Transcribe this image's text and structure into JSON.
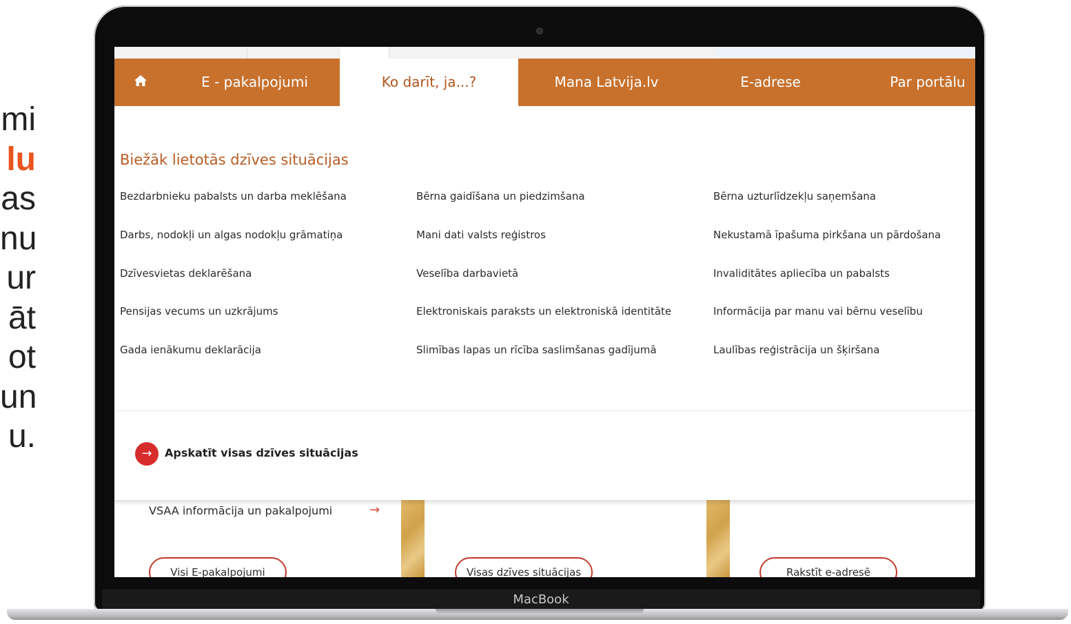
{
  "side_text": {
    "lines": [
      {
        "text": "mi",
        "accent": false
      },
      {
        "text": "lu",
        "accent": true
      },
      {
        "text": "as",
        "accent": false
      },
      {
        "text": "nu",
        "accent": false
      },
      {
        "text": "ur",
        "accent": false
      },
      {
        "text": "āt",
        "accent": false
      },
      {
        "text": "ot",
        "accent": false
      },
      {
        "text": "un",
        "accent": false
      },
      {
        "text": "u.",
        "accent": false
      }
    ]
  },
  "device": {
    "label": "MacBook"
  },
  "nav": {
    "home_icon": "home-icon",
    "items": [
      {
        "label": "E - pakalpojumi",
        "active": false
      },
      {
        "label": "Ko darīt, ja...?",
        "active": true
      },
      {
        "label": "Mana Latvija.lv",
        "active": false
      },
      {
        "label": "E-adrese",
        "active": false
      },
      {
        "label": "Par portālu",
        "active": false
      }
    ]
  },
  "mega_menu": {
    "title": "Biežāk lietotās dzīves situācijas",
    "columns": [
      [
        "Bezdarbnieku pabalsts un darba meklēšana",
        "Darbs, nodokļi un algas nodokļu grāmatiņa",
        "Dzīvesvietas deklarēšana",
        "Pensijas vecums un uzkrājums",
        "Gada ienākumu deklarācija"
      ],
      [
        "Bērna gaidīšana un piedzimšana",
        "Mani dati valsts reģistros",
        "Veselība darbavietā",
        "Elektroniskais paraksts un elektroniskā identitāte",
        "Slimības lapas un rīcība saslimšanas gadījumā"
      ],
      [
        "Bērna uzturlīdzekļu saņemšana",
        "Nekustamā īpašuma pirkšana un pārdošana",
        "Invaliditātes apliecība un pabalsts",
        "Informācija par manu vai bērnu veselību",
        "Laulības reģistrācija un šķiršana"
      ]
    ],
    "see_all_label": "Apskatīt visas dzīves situācijas",
    "see_all_icon": "arrow-right-icon"
  },
  "below": {
    "vsaa_label": "VSAA informācija un pakalpojumi",
    "vsaa_icon": "arrow-right-icon",
    "buttons": [
      "Visi E-pakalpojumi",
      "Visas dzīves situācijas",
      "Rakstīt e-adresē"
    ]
  },
  "colors": {
    "nav_bg": "#c8712d",
    "accent_red": "#d82b2b",
    "title_orange": "#b55c24"
  }
}
